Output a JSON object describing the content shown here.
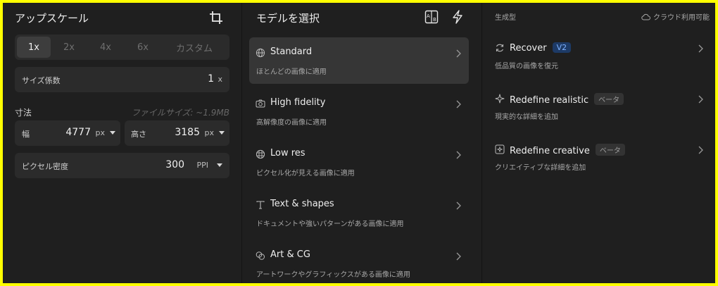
{
  "upscale": {
    "title": "アップスケール",
    "scale_options": [
      "1x",
      "2x",
      "4x",
      "6x",
      "カスタム"
    ],
    "selected_scale": "1x",
    "factor_label": "サイズ係数",
    "factor_value": "1",
    "factor_unit": "x",
    "dimensions_label": "寸法",
    "file_size_hint": "ファイルサイズ: ~1.9MB",
    "width_label": "幅",
    "width_value": "4777",
    "width_unit": "px",
    "height_label": "高さ",
    "height_value": "3185",
    "height_unit": "px",
    "density_label": "ピクセル密度",
    "density_value": "300",
    "density_unit": "PPI"
  },
  "models": {
    "title": "モデルを選択",
    "items": [
      {
        "name": "Standard",
        "desc": "ほとんどの画像に適用",
        "icon": "globe-icon",
        "selected": true
      },
      {
        "name": "High fidelity",
        "desc": "高解像度の画像に適用",
        "icon": "camera-icon",
        "selected": false
      },
      {
        "name": "Low res",
        "desc": "ピクセル化が見える画像に適用",
        "icon": "grid-globe-icon",
        "selected": false
      },
      {
        "name": "Text & shapes",
        "desc": "ドキュメントや強いパターンがある画像に適用",
        "icon": "text-icon",
        "selected": false
      },
      {
        "name": "Art & CG",
        "desc": "アートワークやグラフィックスがある画像に適用",
        "icon": "palette-icon",
        "selected": false
      }
    ]
  },
  "generative": {
    "title": "生成型",
    "cloud_note": "クラウド利用可能",
    "items": [
      {
        "name": "Recover",
        "badge": "V2",
        "desc": "低品質の画像を復元",
        "icon": "refresh-icon"
      },
      {
        "name": "Redefine realistic",
        "badge": "ベータ",
        "desc": "現実的な詳細を追加",
        "icon": "sparkle-icon"
      },
      {
        "name": "Redefine creative",
        "badge": "ベータ",
        "desc": "クリエイティブな詳細を追加",
        "icon": "image-sparkle-icon"
      }
    ]
  },
  "colors": {
    "background": "#1f1f1f",
    "field": "#2b2b2b",
    "selected": "#363636",
    "accent_badge": "#1d3a66",
    "frame": "#ffff00"
  }
}
